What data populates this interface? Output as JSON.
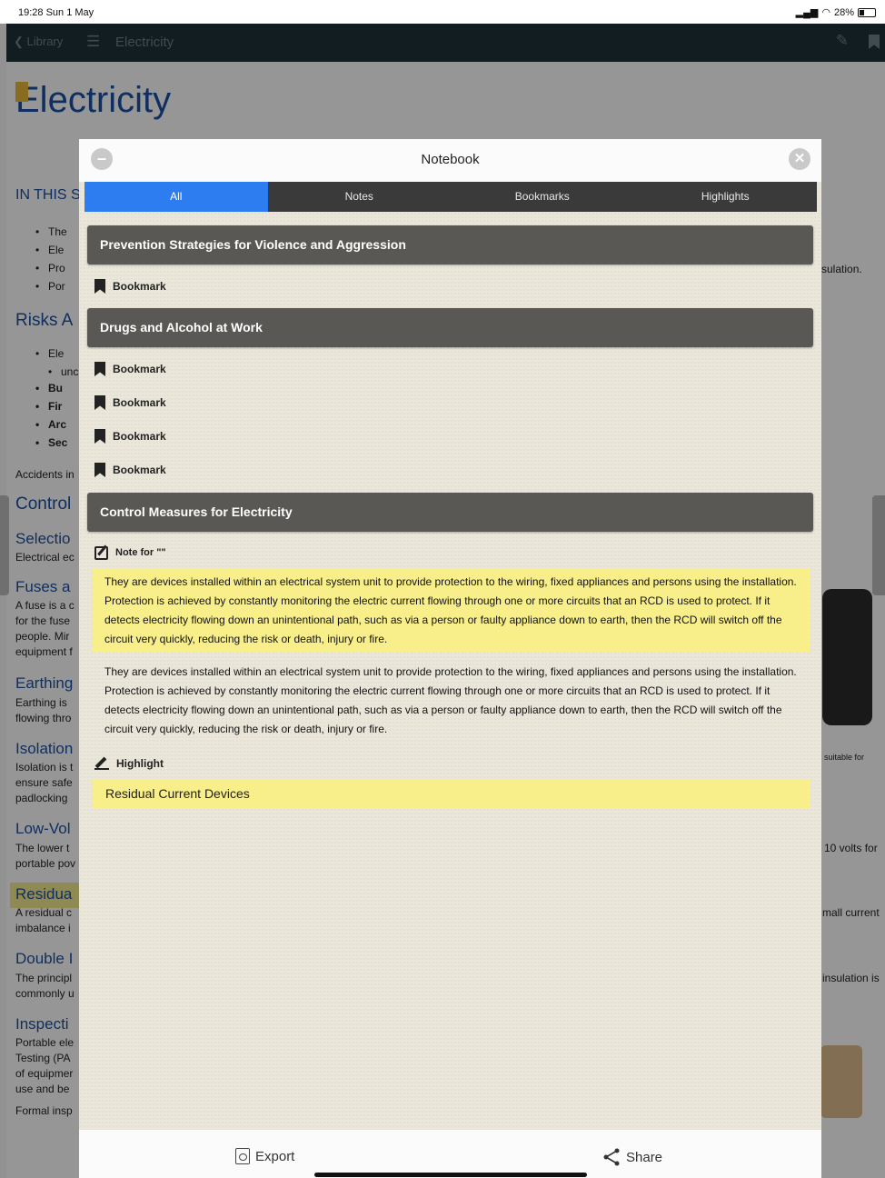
{
  "status_bar": {
    "time": "19:28  Sun 1 May",
    "battery": "28%"
  },
  "app_bar": {
    "back_label": "Library",
    "title": "Electricity"
  },
  "document": {
    "title": "Electricity",
    "in_this": "IN THIS S",
    "bullets_a": [
      "The",
      "Ele",
      "Pro",
      "Por"
    ],
    "bullets_a_tail": "sulation.",
    "risks_heading": "Risks A",
    "bullets_b": [
      "Ele",
      "unc",
      "Bu",
      "Fir",
      "Arc",
      "Sec"
    ],
    "accidents": "Accidents in",
    "control": "Control",
    "selection": "Selectio",
    "selection_text": "Electrical ec",
    "fuses": "Fuses a",
    "fuses_lines": [
      "A fuse is a c",
      "for the fuse",
      "people.  Mir",
      "equipment f"
    ],
    "earthing": "Earthing",
    "earthing_lines": [
      "Earthing is",
      "flowing thro"
    ],
    "isolation": "Isolation",
    "isolation_lines": [
      "Isolation is t",
      "ensure safe",
      "padlocking"
    ],
    "isolation_tail": "suitable for",
    "lowvolt": "Low-Vol",
    "lowvolt_lines": [
      "The lower t",
      "portable pov"
    ],
    "lowvolt_tail": "10 volts for",
    "residual": "Residua",
    "residual_lines": [
      "A residual c",
      "imbalance i"
    ],
    "residual_tail": "mall current",
    "double": "Double I",
    "double_lines": [
      "The principl",
      "commonly u"
    ],
    "double_tail": "insulation is",
    "inspection": "Inspecti",
    "inspection_lines": [
      "Portable ele",
      "Testing (PA",
      "of equipmer",
      "use and be"
    ],
    "formal": "Formal insp"
  },
  "notebook": {
    "title": "Notebook",
    "tabs": [
      "All",
      "Notes",
      "Bookmarks",
      "Highlights"
    ],
    "sections": [
      "Prevention Strategies for Violence and Aggression",
      "Drugs and Alcohol at Work",
      "Control Measures for Electricity"
    ],
    "bookmark_label": "Bookmark",
    "note_label": "Note for \"\"",
    "note_quote": "They are devices installed within an electrical system unit to provide protection to the wiring, fixed appliances and persons using the installation. Protection is achieved by constantly monitoring the electric current flowing through one or more circuits that an RCD is used to protect. If it detects electricity flowing down an unintentional path, such as via a person or faulty appliance down to earth, then the RCD will switch off the circuit very quickly, reducing the risk or death, injury or fire.",
    "note_body": "They are devices installed within an electrical system unit to provide protection to the wiring, fixed appliances and persons using the installation. Protection is achieved by constantly monitoring the electric current flowing through one or more circuits that an RCD is used to protect. If it detects electricity flowing down an unintentional path, such as via a person or faulty appliance down to earth, then the RCD will switch off the circuit very quickly, reducing the risk or death, injury or fire.",
    "highlight_label": "Highlight",
    "highlight_text": "Residual Current Devices",
    "export_label": "Export",
    "share_label": "Share"
  },
  "colors": {
    "accent": "#2d7cf0",
    "highlight": "#f8ee8a",
    "section_header": "#5a5855",
    "appbar": "#1f3138"
  },
  "icons": [
    "chevron-left-icon",
    "menu-icon",
    "edit-icon",
    "bookmark-icon",
    "minimize-icon",
    "close-icon",
    "note-icon",
    "highlight-pen-icon",
    "pdf-icon",
    "share-icon"
  ]
}
